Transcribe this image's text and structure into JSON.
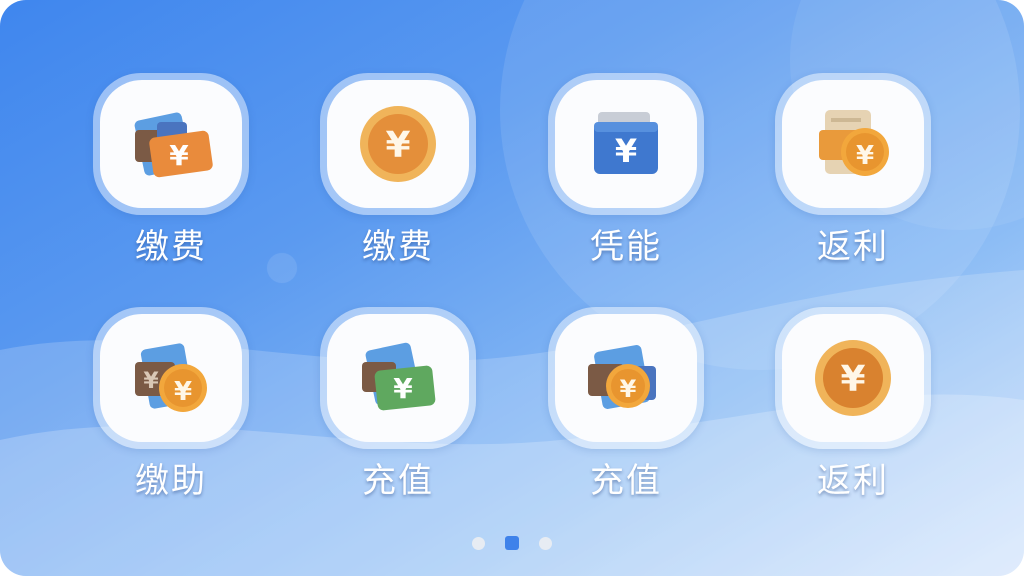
{
  "apps": [
    {
      "label": "缴费",
      "icon": "cards-yen-icon"
    },
    {
      "label": "缴费",
      "icon": "yen-coin-icon"
    },
    {
      "label": "凭能",
      "icon": "blue-wallet-yen-icon"
    },
    {
      "label": "返利",
      "icon": "receipt-coin-icon"
    },
    {
      "label": "缴助",
      "icon": "cards-coin-icon"
    },
    {
      "label": "充值",
      "icon": "green-card-yen-icon"
    },
    {
      "label": "充值",
      "icon": "cards-coin-icon"
    },
    {
      "label": "返利",
      "icon": "yen-coin-icon"
    }
  ],
  "pagination": {
    "pages": 3,
    "current": 2
  },
  "colors": {
    "background_top": "#3f86ee",
    "background_bottom": "#cfe2fb",
    "active_dot": "#3f82ea",
    "inactive_dot": "#e7ecf3",
    "coin": "#e99a3b",
    "card_blue": "#4a86d6",
    "card_green": "#64ad62"
  }
}
